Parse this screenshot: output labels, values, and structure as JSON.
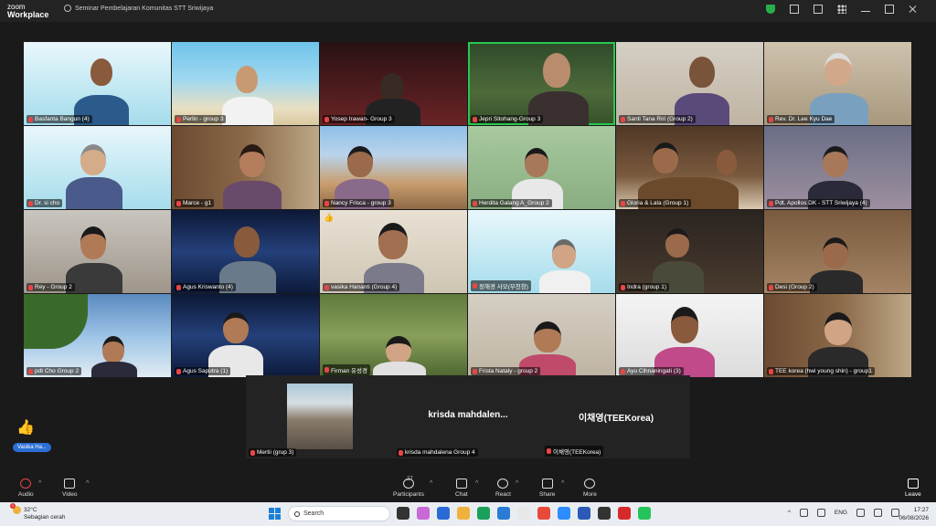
{
  "app": {
    "logo_line1": "zoom",
    "logo_line2": "Workplace",
    "meeting_title": "Seminar Pembelajaran Komunitas STT Sriwijaya"
  },
  "participants": [
    {
      "name": "Basfanta Bangun (4)"
    },
    {
      "name": "Perlin - group 3"
    },
    {
      "name": "Yosep Irawan- Group 3"
    },
    {
      "name": "Jepri Sitohang-Group 3"
    },
    {
      "name": "Santi Tana Riri (Group 2)"
    },
    {
      "name": "Rev. Dr. Lee Kyu Dae"
    },
    {
      "name": "Dr. si cho"
    },
    {
      "name": "Marce - g1"
    },
    {
      "name": "Nancy Frisca - group 3"
    },
    {
      "name": "Herdita Galang A_Group 2"
    },
    {
      "name": "Gloria & Lala (Group 1)"
    },
    {
      "name": "Pdt. Apollos DK - STT Sriwijaya (4)"
    },
    {
      "name": "Rey - Group 2"
    },
    {
      "name": "Agus Kriswanto (4)"
    },
    {
      "name": "vasika Hananti (Group 4)"
    },
    {
      "name": "정해경 사모(부천창)"
    },
    {
      "name": "Indra (group 1)"
    },
    {
      "name": "Desi (Group 2)"
    },
    {
      "name": "pdt Cho Group 2"
    },
    {
      "name": "Agus Saputra (1)"
    },
    {
      "name": "Firman 유성경"
    },
    {
      "name": "Frista Nataly - group 2"
    },
    {
      "name": "Ayu Cihnaningati (3)"
    },
    {
      "name": "TEE korea (hwi young shin) - group1"
    }
  ],
  "strip": [
    {
      "name": "Mertii (grup 3)",
      "display": ""
    },
    {
      "name": "krisda mahdalena Group 4",
      "display": "krisda  mahdalen..."
    },
    {
      "name": "이채영(TEEKorea)",
      "display": "이채영(TEEKorea)"
    }
  ],
  "reaction": {
    "emoji": "👍",
    "label": "Vasika Ha..."
  },
  "toolbar": {
    "audio": "Audio",
    "video": "Video",
    "participants": "Participants",
    "participant_count": "27",
    "chat": "Chat",
    "react": "React",
    "share": "Share",
    "more": "More",
    "leave": "Leave"
  },
  "taskbar": {
    "temp": "32°C",
    "weather": "Sebagian cerah",
    "weather_badge": "1",
    "search_placeholder": "Search",
    "lang": "ENG",
    "time": "17:27",
    "date": "06/08/2026"
  },
  "colors": {
    "active_speaker": "#28c850",
    "mic_muted": "#e84545",
    "leave": "#e02f2f"
  }
}
